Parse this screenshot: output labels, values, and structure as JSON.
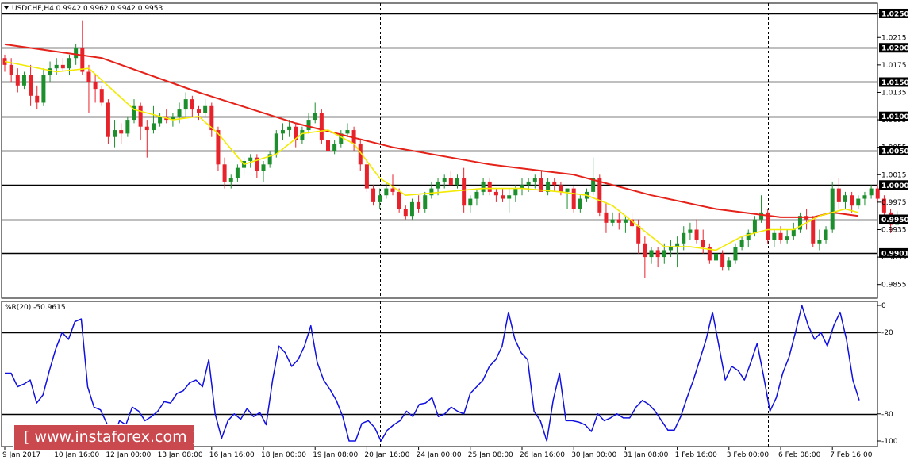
{
  "header": {
    "symbol_line": "USDCHF,H4  0.9942 0.9962 0.9942 0.9953",
    "indicator_line": "%R(20) -50.9615"
  },
  "watermark": "[ www.instaforex.com ]",
  "colors": {
    "bull": "#1c8f2c",
    "bear": "#e8222b",
    "ma_slow": "#e52219",
    "ma_fast": "#f2ea00",
    "wpr": "#1010e0",
    "levels": "#000000"
  },
  "chart_data": [
    {
      "type": "candlestick",
      "instrument": "USDCHF",
      "timeframe": "H4",
      "ylim": [
        0.9835,
        1.0265
      ],
      "yticks": [
        "1.0250",
        "1.0215",
        "1.0175",
        "1.0135",
        "1.0095",
        "1.0055",
        "1.0015",
        "0.9975",
        "0.9935",
        "0.9895",
        "0.9855"
      ],
      "level_tags": [
        "1.0250",
        "1.0200",
        "1.0150",
        "1.0100",
        "1.0050",
        "1.0000",
        "0.9950",
        "0.9901"
      ],
      "x_labels": [
        "9 Jan 2017",
        "10 Jan 16:00",
        "12 Jan 00:00",
        "13 Jan 08:00",
        "16 Jan 16:00",
        "18 Jan 00:00",
        "19 Jan 08:00",
        "20 Jan 16:00",
        "24 Jan 00:00",
        "25 Jan 08:00",
        "26 Jan 16:00",
        "30 Jan 00:00",
        "31 Jan 08:00",
        "1 Feb 16:00",
        "3 Feb 00:00",
        "6 Feb 08:00",
        "7 Feb 16:00"
      ],
      "x_label_bars": [
        0,
        8,
        16,
        24,
        32,
        40,
        48,
        56,
        64,
        72,
        80,
        88,
        96,
        104,
        112,
        120,
        128
      ],
      "vlines_at_bars": [
        28,
        58,
        88,
        118
      ],
      "ohlc": [
        [
          1.0185,
          1.019,
          1.0165,
          1.0175
        ],
        [
          1.0175,
          1.0185,
          1.015,
          1.016
        ],
        [
          1.016,
          1.017,
          1.0135,
          1.0145
        ],
        [
          1.0145,
          1.0165,
          1.014,
          1.016
        ],
        [
          1.016,
          1.0175,
          1.0115,
          1.013
        ],
        [
          1.013,
          1.0145,
          1.011,
          1.012
        ],
        [
          1.012,
          1.017,
          1.0115,
          1.016
        ],
        [
          1.016,
          1.018,
          1.015,
          1.017
        ],
        [
          1.017,
          1.0185,
          1.016,
          1.0175
        ],
        [
          1.0175,
          1.0185,
          1.0165,
          1.017
        ],
        [
          1.017,
          1.019,
          1.016,
          1.0185
        ],
        [
          1.0185,
          1.0205,
          1.0175,
          1.02
        ],
        [
          1.02,
          1.024,
          1.016,
          1.0165
        ],
        [
          1.0165,
          1.0175,
          1.0105,
          1.015
        ],
        [
          1.015,
          1.016,
          1.012,
          1.014
        ],
        [
          1.014,
          1.0145,
          1.0115,
          1.012
        ],
        [
          1.012,
          1.0125,
          1.006,
          1.007
        ],
        [
          1.007,
          1.0095,
          1.0055,
          1.008
        ],
        [
          1.008,
          1.009,
          1.006,
          1.0075
        ],
        [
          1.0075,
          1.01,
          1.007,
          1.0095
        ],
        [
          1.0095,
          1.0125,
          1.009,
          1.0115
        ],
        [
          1.0115,
          1.012,
          1.0065,
          1.0085
        ],
        [
          1.0085,
          1.0095,
          1.004,
          1.008
        ],
        [
          1.008,
          1.0115,
          1.0075,
          1.009
        ],
        [
          1.009,
          1.0105,
          1.0085,
          1.01
        ],
        [
          1.01,
          1.011,
          1.009,
          1.0095
        ],
        [
          1.0095,
          1.0105,
          1.0085,
          1.01
        ],
        [
          1.01,
          1.012,
          1.009,
          1.011
        ],
        [
          1.011,
          1.0135,
          1.01,
          1.0125
        ],
        [
          1.0125,
          1.013,
          1.01,
          1.011
        ],
        [
          1.011,
          1.0115,
          1.0095,
          1.0105
        ],
        [
          1.0105,
          1.0125,
          1.01,
          1.0115
        ],
        [
          1.0115,
          1.012,
          1.007,
          1.008
        ],
        [
          1.008,
          1.0085,
          1.002,
          1.003
        ],
        [
          1.003,
          1.004,
          0.9995,
          1.0005
        ],
        [
          1.0005,
          1.0015,
          0.9995,
          1.001
        ],
        [
          1.001,
          1.003,
          1.0005,
          1.0025
        ],
        [
          1.0025,
          1.004,
          1.0015,
          1.0035
        ],
        [
          1.0035,
          1.0045,
          1.0025,
          1.004
        ],
        [
          1.004,
          1.0045,
          1.001,
          1.002
        ],
        [
          1.002,
          1.0035,
          1.0005,
          1.003
        ],
        [
          1.003,
          1.005,
          1.0025,
          1.0045
        ],
        [
          1.0045,
          1.008,
          1.004,
          1.0075
        ],
        [
          1.0075,
          1.009,
          1.0065,
          1.008
        ],
        [
          1.008,
          1.0095,
          1.007,
          1.0085
        ],
        [
          1.0085,
          1.009,
          1.0055,
          1.0065
        ],
        [
          1.0065,
          1.0085,
          1.006,
          1.008
        ],
        [
          1.008,
          1.0105,
          1.0075,
          1.0095
        ],
        [
          1.0095,
          1.012,
          1.009,
          1.0105
        ],
        [
          1.0105,
          1.011,
          1.006,
          1.0065
        ],
        [
          1.0065,
          1.0075,
          1.004,
          1.005
        ],
        [
          1.005,
          1.0065,
          1.0045,
          1.006
        ],
        [
          1.006,
          1.008,
          1.0055,
          1.0075
        ],
        [
          1.0075,
          1.009,
          1.007,
          1.008
        ],
        [
          1.008,
          1.0085,
          1.005,
          1.006
        ],
        [
          1.006,
          1.0065,
          1.002,
          1.003
        ],
        [
          1.003,
          1.0035,
          0.999,
          0.9995
        ],
        [
          0.9995,
          1.0,
          0.997,
          0.9975
        ],
        [
          0.9975,
          0.9995,
          0.9965,
          0.9985
        ],
        [
          0.9985,
          1.0005,
          0.998,
          0.9995
        ],
        [
          0.9995,
          1.0015,
          0.9985,
          0.999
        ],
        [
          0.999,
          0.9995,
          0.996,
          0.9965
        ],
        [
          0.9965,
          0.997,
          0.995,
          0.9955
        ],
        [
          0.9955,
          0.998,
          0.995,
          0.9975
        ],
        [
          0.9975,
          0.9985,
          0.996,
          0.9965
        ],
        [
          0.9965,
          0.999,
          0.996,
          0.9985
        ],
        [
          0.9985,
          1.0005,
          0.998,
          0.9995
        ],
        [
          0.9995,
          1.001,
          0.9985,
          1.0005
        ],
        [
          1.0005,
          1.0015,
          0.9995,
          1.001
        ],
        [
          1.001,
          1.002,
          1.0,
          1.0
        ],
        [
          1.0,
          1.0015,
          0.9995,
          1.001
        ],
        [
          1.001,
          1.0025,
          0.996,
          0.997
        ],
        [
          0.997,
          0.9985,
          0.996,
          0.998
        ],
        [
          0.998,
          0.9995,
          0.997,
          0.999
        ],
        [
          0.999,
          1.001,
          0.9985,
          1.0005
        ],
        [
          1.0005,
          1.001,
          0.9985,
          0.999
        ],
        [
          0.999,
          0.9995,
          0.9975,
          0.9985
        ],
        [
          0.9985,
          0.9995,
          0.9975,
          0.998
        ],
        [
          0.998,
          0.9995,
          0.996,
          0.9985
        ],
        [
          0.9985,
          1.0,
          0.9975,
          0.9995
        ],
        [
          0.9995,
          1.001,
          0.9985,
          1.0
        ],
        [
          1.0,
          1.001,
          0.999,
          1.0005
        ],
        [
          1.0005,
          1.0015,
          0.9995,
          1.001
        ],
        [
          1.001,
          1.002,
          1.0,
          0.999
        ],
        [
          0.999,
          1.001,
          0.9985,
          1.0005
        ],
        [
          1.0005,
          1.001,
          0.999,
          1.0
        ],
        [
          1.0,
          1.0005,
          0.9985,
          0.999
        ],
        [
          0.999,
          0.9995,
          0.9965,
          0.9995
        ],
        [
          0.9995,
          0.9998,
          0.996,
          0.9965
        ],
        [
          0.9965,
          0.9985,
          0.996,
          0.998
        ],
        [
          0.998,
          0.9995,
          0.9975,
          0.999
        ],
        [
          0.999,
          1.004,
          0.9985,
          1.001
        ],
        [
          1.001,
          1.0015,
          0.9955,
          0.996
        ],
        [
          0.996,
          0.9975,
          0.993,
          0.9945
        ],
        [
          0.9945,
          0.996,
          0.994,
          0.995
        ],
        [
          0.995,
          0.996,
          0.9935,
          0.9945
        ],
        [
          0.9945,
          0.9955,
          0.993,
          0.995
        ],
        [
          0.995,
          0.996,
          0.9935,
          0.994
        ],
        [
          0.994,
          0.995,
          0.99,
          0.9915
        ],
        [
          0.9915,
          0.9925,
          0.9865,
          0.9895
        ],
        [
          0.9895,
          0.991,
          0.9885,
          0.9905
        ],
        [
          0.9905,
          0.991,
          0.988,
          0.9895
        ],
        [
          0.9895,
          0.9915,
          0.9885,
          0.9905
        ],
        [
          0.9905,
          0.992,
          0.9895,
          0.991
        ],
        [
          0.991,
          0.9925,
          0.988,
          0.9915
        ],
        [
          0.9915,
          0.994,
          0.9905,
          0.993
        ],
        [
          0.993,
          0.9945,
          0.992,
          0.9935
        ],
        [
          0.9935,
          0.995,
          0.9915,
          0.992
        ],
        [
          0.992,
          0.9935,
          0.99,
          0.991
        ],
        [
          0.991,
          0.9915,
          0.9885,
          0.989
        ],
        [
          0.989,
          0.9905,
          0.9875,
          0.99
        ],
        [
          0.99,
          0.9905,
          0.9875,
          0.988
        ],
        [
          0.988,
          0.9895,
          0.9875,
          0.989
        ],
        [
          0.989,
          0.9915,
          0.9885,
          0.991
        ],
        [
          0.991,
          0.9925,
          0.9905,
          0.992
        ],
        [
          0.992,
          0.9935,
          0.991,
          0.993
        ],
        [
          0.993,
          0.9955,
          0.9925,
          0.995
        ],
        [
          0.995,
          0.9985,
          0.9945,
          0.996
        ],
        [
          0.996,
          0.9965,
          0.9915,
          0.992
        ],
        [
          0.992,
          0.9935,
          0.991,
          0.993
        ],
        [
          0.993,
          0.994,
          0.9915,
          0.992
        ],
        [
          0.992,
          0.9935,
          0.9915,
          0.9925
        ],
        [
          0.9925,
          0.9945,
          0.992,
          0.9935
        ],
        [
          0.9935,
          0.996,
          0.993,
          0.9955
        ],
        [
          0.9955,
          0.9965,
          0.9935,
          0.995
        ],
        [
          0.995,
          0.9955,
          0.991,
          0.9915
        ],
        [
          0.9915,
          0.9935,
          0.9905,
          0.992
        ],
        [
          0.992,
          0.994,
          0.9915,
          0.9935
        ],
        [
          0.9935,
          1.0005,
          0.993,
          0.9995
        ],
        [
          0.9995,
          1.001,
          0.9965,
          0.9975
        ],
        [
          0.9975,
          0.999,
          0.9965,
          0.9985
        ],
        [
          0.9985,
          0.999,
          0.996,
          0.997
        ],
        [
          0.997,
          0.9985,
          0.9965,
          0.998
        ],
        [
          0.998,
          0.999,
          0.997,
          0.9985
        ],
        [
          0.9985,
          1.0,
          0.998,
          0.9995
        ],
        [
          0.9995,
          1.0,
          0.9975,
          0.998
        ],
        [
          0.998,
          0.9985,
          0.9955,
          0.996
        ],
        [
          0.996,
          0.9965,
          0.993,
          0.9942
        ],
        [
          0.9942,
          0.9962,
          0.9942,
          0.9953
        ]
      ],
      "ma_slow": [
        [
          0,
          1.0205
        ],
        [
          15,
          1.0185
        ],
        [
          30,
          1.0135
        ],
        [
          45,
          1.009
        ],
        [
          60,
          1.0055
        ],
        [
          75,
          1.003
        ],
        [
          88,
          1.0015
        ],
        [
          100,
          0.9985
        ],
        [
          110,
          0.9965
        ],
        [
          120,
          0.9953
        ],
        [
          125,
          0.9953
        ],
        [
          128,
          0.996
        ],
        [
          132,
          0.9955
        ]
      ],
      "ma_fast": [
        [
          0,
          1.018
        ],
        [
          8,
          1.0165
        ],
        [
          13,
          1.017
        ],
        [
          20,
          1.011
        ],
        [
          26,
          1.0095
        ],
        [
          30,
          1.01
        ],
        [
          33,
          1.0075
        ],
        [
          37,
          1.003
        ],
        [
          42,
          1.0045
        ],
        [
          46,
          1.0075
        ],
        [
          50,
          1.008
        ],
        [
          54,
          1.006
        ],
        [
          58,
          1.001
        ],
        [
          62,
          0.9985
        ],
        [
          68,
          0.999
        ],
        [
          74,
          0.9995
        ],
        [
          80,
          0.9995
        ],
        [
          86,
          0.999
        ],
        [
          90,
          0.9985
        ],
        [
          94,
          0.997
        ],
        [
          98,
          0.994
        ],
        [
          102,
          0.991
        ],
        [
          106,
          0.991
        ],
        [
          110,
          0.9905
        ],
        [
          114,
          0.9925
        ],
        [
          118,
          0.9935
        ],
        [
          122,
          0.9935
        ],
        [
          126,
          0.9955
        ],
        [
          130,
          0.9965
        ],
        [
          132,
          0.996
        ]
      ]
    },
    {
      "type": "line",
      "indicator": "%R(20)",
      "ylim": [
        -100,
        0
      ],
      "yticks": [
        "0",
        "-20",
        "-80",
        "-100"
      ],
      "levels": [
        -20,
        -80
      ],
      "values": [
        -50,
        -50,
        -60,
        -58,
        -55,
        -72,
        -66,
        -48,
        -32,
        -20,
        -25,
        -12,
        -10,
        -60,
        -75,
        -77,
        -87,
        -97,
        -85,
        -88,
        -75,
        -78,
        -85,
        -82,
        -78,
        -71,
        -72,
        -65,
        -63,
        -57,
        -55,
        -60,
        -40,
        -80,
        -98,
        -85,
        -80,
        -84,
        -76,
        -82,
        -79,
        -88,
        -55,
        -30,
        -35,
        -45,
        -40,
        -30,
        -15,
        -42,
        -55,
        -62,
        -70,
        -82,
        -100,
        -100,
        -87,
        -85,
        -90,
        -100,
        -92,
        -88,
        -85,
        -78,
        -82,
        -73,
        -72,
        -68,
        -82,
        -80,
        -75,
        -78,
        -80,
        -65,
        -60,
        -55,
        -45,
        -40,
        -30,
        -5,
        -25,
        -35,
        -40,
        -78,
        -85,
        -100,
        -70,
        -50,
        -85,
        -85,
        -86,
        -88,
        -93,
        -80,
        -85,
        -83,
        -80,
        -83,
        -83,
        -75,
        -70,
        -73,
        -78,
        -85,
        -92,
        -92,
        -82,
        -68,
        -55,
        -40,
        -25,
        -5,
        -30,
        -55,
        -45,
        -48,
        -55,
        -42,
        -28,
        -52,
        -78,
        -68,
        -50,
        -38,
        -20,
        0,
        -15,
        -25,
        -20,
        -30,
        -15,
        -5,
        -25,
        -55,
        -70
      ]
    }
  ]
}
